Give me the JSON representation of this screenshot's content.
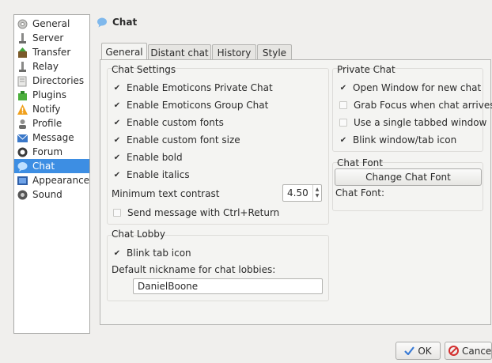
{
  "header": {
    "title": "Chat"
  },
  "sidebar": {
    "items": [
      {
        "label": "General",
        "icon": "gear-icon"
      },
      {
        "label": "Server",
        "icon": "server-icon"
      },
      {
        "label": "Transfer",
        "icon": "transfer-icon"
      },
      {
        "label": "Relay",
        "icon": "relay-icon"
      },
      {
        "label": "Directories",
        "icon": "folder-icon"
      },
      {
        "label": "Plugins",
        "icon": "plugin-icon"
      },
      {
        "label": "Notify",
        "icon": "warning-icon"
      },
      {
        "label": "Profile",
        "icon": "profile-icon"
      },
      {
        "label": "Message",
        "icon": "message-icon"
      },
      {
        "label": "Forum",
        "icon": "forum-icon"
      },
      {
        "label": "Chat",
        "icon": "chat-icon",
        "selected": true
      },
      {
        "label": "Appearance",
        "icon": "appearance-icon"
      },
      {
        "label": "Sound",
        "icon": "sound-icon"
      }
    ]
  },
  "tabs": [
    {
      "label": "General",
      "active": true
    },
    {
      "label": "Distant chat"
    },
    {
      "label": "History"
    },
    {
      "label": "Style"
    }
  ],
  "chat_settings": {
    "title": "Chat Settings",
    "options": [
      {
        "label": "Enable Emoticons Private Chat",
        "checked": true
      },
      {
        "label": "Enable Emoticons Group Chat",
        "checked": true
      },
      {
        "label": "Enable custom fonts",
        "checked": true
      },
      {
        "label": "Enable custom font size",
        "checked": true
      },
      {
        "label": "Enable bold",
        "checked": true
      },
      {
        "label": "Enable italics",
        "checked": true
      }
    ],
    "min_contrast_label": "Minimum text contrast",
    "min_contrast_value": "4.50",
    "ctrl_return_label": "Send message with Ctrl+Return",
    "ctrl_return_checked": false
  },
  "chat_lobby": {
    "title": "Chat Lobby",
    "blink_label": "Blink tab icon",
    "blink_checked": true,
    "nickname_label": "Default nickname for chat lobbies:",
    "nickname_value": "DanielBoone"
  },
  "private_chat": {
    "title": "Private Chat",
    "options": [
      {
        "label": "Open Window for new chat",
        "checked": true
      },
      {
        "label": "Grab Focus when chat arrives",
        "checked": false
      },
      {
        "label": "Use a single tabbed window",
        "checked": false
      },
      {
        "label": "Blink window/tab icon",
        "checked": true
      }
    ]
  },
  "chat_font": {
    "title": "Chat Font",
    "button_label": "Change Chat Font",
    "current_label": "Chat Font:"
  },
  "buttons": {
    "ok_label": "OK",
    "cancel_label": "Cancel"
  }
}
